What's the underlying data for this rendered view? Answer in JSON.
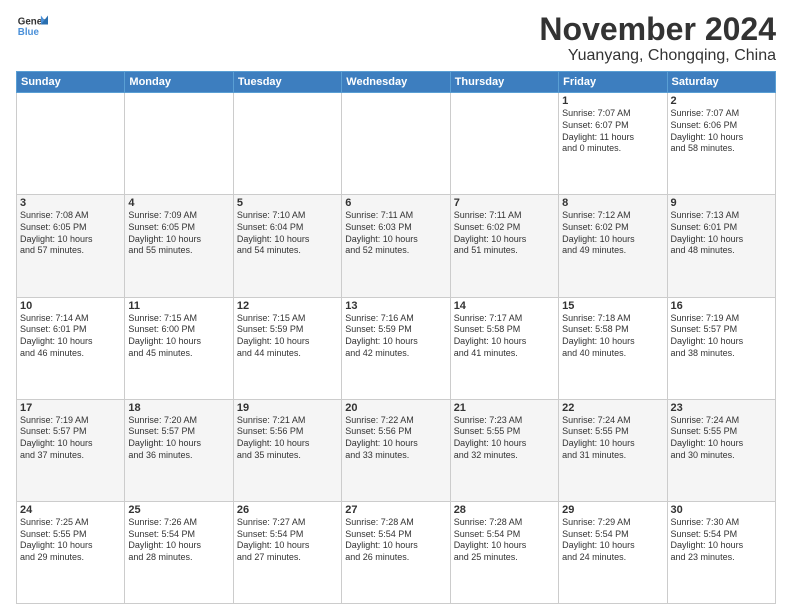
{
  "header": {
    "logo_general": "General",
    "logo_blue": "Blue",
    "month": "November 2024",
    "location": "Yuanyang, Chongqing, China"
  },
  "days_of_week": [
    "Sunday",
    "Monday",
    "Tuesday",
    "Wednesday",
    "Thursday",
    "Friday",
    "Saturday"
  ],
  "weeks": [
    [
      {
        "day": "",
        "info": ""
      },
      {
        "day": "",
        "info": ""
      },
      {
        "day": "",
        "info": ""
      },
      {
        "day": "",
        "info": ""
      },
      {
        "day": "",
        "info": ""
      },
      {
        "day": "1",
        "info": "Sunrise: 7:07 AM\nSunset: 6:07 PM\nDaylight: 11 hours\nand 0 minutes."
      },
      {
        "day": "2",
        "info": "Sunrise: 7:07 AM\nSunset: 6:06 PM\nDaylight: 10 hours\nand 58 minutes."
      }
    ],
    [
      {
        "day": "3",
        "info": "Sunrise: 7:08 AM\nSunset: 6:05 PM\nDaylight: 10 hours\nand 57 minutes."
      },
      {
        "day": "4",
        "info": "Sunrise: 7:09 AM\nSunset: 6:05 PM\nDaylight: 10 hours\nand 55 minutes."
      },
      {
        "day": "5",
        "info": "Sunrise: 7:10 AM\nSunset: 6:04 PM\nDaylight: 10 hours\nand 54 minutes."
      },
      {
        "day": "6",
        "info": "Sunrise: 7:11 AM\nSunset: 6:03 PM\nDaylight: 10 hours\nand 52 minutes."
      },
      {
        "day": "7",
        "info": "Sunrise: 7:11 AM\nSunset: 6:02 PM\nDaylight: 10 hours\nand 51 minutes."
      },
      {
        "day": "8",
        "info": "Sunrise: 7:12 AM\nSunset: 6:02 PM\nDaylight: 10 hours\nand 49 minutes."
      },
      {
        "day": "9",
        "info": "Sunrise: 7:13 AM\nSunset: 6:01 PM\nDaylight: 10 hours\nand 48 minutes."
      }
    ],
    [
      {
        "day": "10",
        "info": "Sunrise: 7:14 AM\nSunset: 6:01 PM\nDaylight: 10 hours\nand 46 minutes."
      },
      {
        "day": "11",
        "info": "Sunrise: 7:15 AM\nSunset: 6:00 PM\nDaylight: 10 hours\nand 45 minutes."
      },
      {
        "day": "12",
        "info": "Sunrise: 7:15 AM\nSunset: 5:59 PM\nDaylight: 10 hours\nand 44 minutes."
      },
      {
        "day": "13",
        "info": "Sunrise: 7:16 AM\nSunset: 5:59 PM\nDaylight: 10 hours\nand 42 minutes."
      },
      {
        "day": "14",
        "info": "Sunrise: 7:17 AM\nSunset: 5:58 PM\nDaylight: 10 hours\nand 41 minutes."
      },
      {
        "day": "15",
        "info": "Sunrise: 7:18 AM\nSunset: 5:58 PM\nDaylight: 10 hours\nand 40 minutes."
      },
      {
        "day": "16",
        "info": "Sunrise: 7:19 AM\nSunset: 5:57 PM\nDaylight: 10 hours\nand 38 minutes."
      }
    ],
    [
      {
        "day": "17",
        "info": "Sunrise: 7:19 AM\nSunset: 5:57 PM\nDaylight: 10 hours\nand 37 minutes."
      },
      {
        "day": "18",
        "info": "Sunrise: 7:20 AM\nSunset: 5:57 PM\nDaylight: 10 hours\nand 36 minutes."
      },
      {
        "day": "19",
        "info": "Sunrise: 7:21 AM\nSunset: 5:56 PM\nDaylight: 10 hours\nand 35 minutes."
      },
      {
        "day": "20",
        "info": "Sunrise: 7:22 AM\nSunset: 5:56 PM\nDaylight: 10 hours\nand 33 minutes."
      },
      {
        "day": "21",
        "info": "Sunrise: 7:23 AM\nSunset: 5:55 PM\nDaylight: 10 hours\nand 32 minutes."
      },
      {
        "day": "22",
        "info": "Sunrise: 7:24 AM\nSunset: 5:55 PM\nDaylight: 10 hours\nand 31 minutes."
      },
      {
        "day": "23",
        "info": "Sunrise: 7:24 AM\nSunset: 5:55 PM\nDaylight: 10 hours\nand 30 minutes."
      }
    ],
    [
      {
        "day": "24",
        "info": "Sunrise: 7:25 AM\nSunset: 5:55 PM\nDaylight: 10 hours\nand 29 minutes."
      },
      {
        "day": "25",
        "info": "Sunrise: 7:26 AM\nSunset: 5:54 PM\nDaylight: 10 hours\nand 28 minutes."
      },
      {
        "day": "26",
        "info": "Sunrise: 7:27 AM\nSunset: 5:54 PM\nDaylight: 10 hours\nand 27 minutes."
      },
      {
        "day": "27",
        "info": "Sunrise: 7:28 AM\nSunset: 5:54 PM\nDaylight: 10 hours\nand 26 minutes."
      },
      {
        "day": "28",
        "info": "Sunrise: 7:28 AM\nSunset: 5:54 PM\nDaylight: 10 hours\nand 25 minutes."
      },
      {
        "day": "29",
        "info": "Sunrise: 7:29 AM\nSunset: 5:54 PM\nDaylight: 10 hours\nand 24 minutes."
      },
      {
        "day": "30",
        "info": "Sunrise: 7:30 AM\nSunset: 5:54 PM\nDaylight: 10 hours\nand 23 minutes."
      }
    ]
  ]
}
